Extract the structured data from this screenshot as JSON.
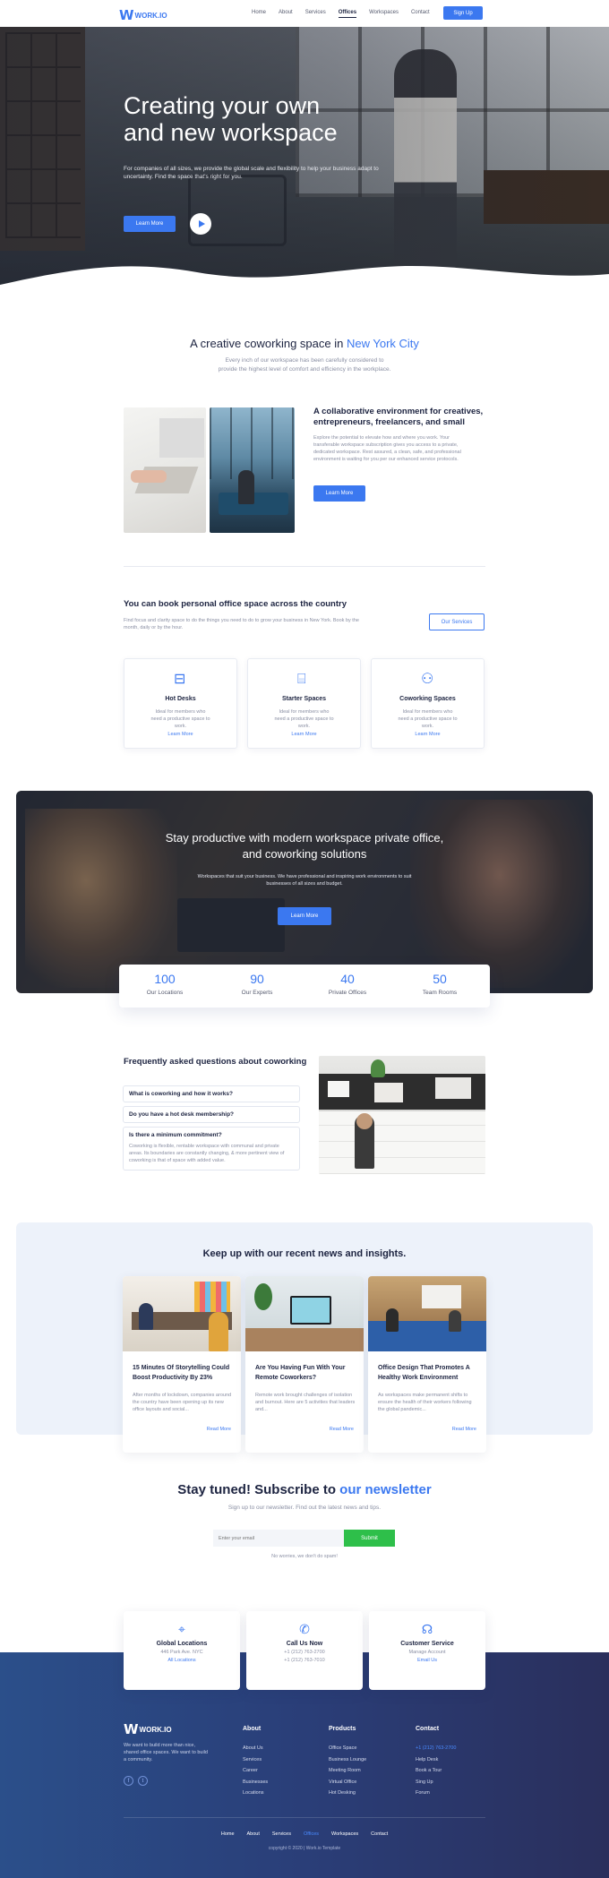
{
  "nav": {
    "logo_mark": "W",
    "logo_text": "WORK.IO",
    "links": [
      "Home",
      "About",
      "Services",
      "Offices",
      "Workspaces",
      "Contact"
    ],
    "active_link": "Offices",
    "signup": "Sign Up"
  },
  "hero": {
    "title_line1": "Creating your own",
    "title_line2": "and new workspace",
    "subtitle": "For companies of all sizes, we provide the global scale and flexibility to help your business adapt to uncertainty. Find the space that's right for you.",
    "button": "Learn More"
  },
  "coworking": {
    "title_prefix": "A creative coworking space in",
    "title_accent": "New York City",
    "subtitle_line1": "Every inch of our workspace has been carefully considered to",
    "subtitle_line2": "provide the highest level of comfort and efficiency in the workplace.",
    "feature_title": "A collaborative environment for creatives, entrepreneurs, freelancers, and small",
    "feature_text": "Explore the potential to elevate how and where you work. Your transferable workspace subscription gives you access to a private, dedicated workspace. Rest assured, a clean, safe, and professional environment is waiting for you per our enhanced service protocols.",
    "feature_button": "Learn More"
  },
  "offices": {
    "title": "You can book personal office space across the country",
    "text": "Find focus and clarity space to do the things you need to do to grow your business in New York. Book by the month, daily or by the hour.",
    "button": "Our Services",
    "cards": [
      {
        "icon": "desk-icon",
        "title": "Hot Desks",
        "text": "Ideal for members who need a productive space to work.",
        "link": "Learn More"
      },
      {
        "icon": "whiteboard-icon",
        "title": "Starter Spaces",
        "text": "Ideal for members who need a productive space to work.",
        "link": "Learn More"
      },
      {
        "icon": "people-icon",
        "title": "Coworking Spaces",
        "text": "Ideal for members who need a productive space to work.",
        "link": "Learn More"
      }
    ]
  },
  "banner": {
    "title": "Stay productive with modern workspace private office, and coworking solutions",
    "text": "Workspaces that suit your business. We have professional and inspiring work environments to suit businesses of all sizes and budget.",
    "button": "Learn More",
    "stats": [
      {
        "value": "100",
        "label": "Our Locations"
      },
      {
        "value": "90",
        "label": "Our Experts"
      },
      {
        "value": "40",
        "label": "Private Offices"
      },
      {
        "value": "50",
        "label": "Team Rooms"
      }
    ]
  },
  "faq": {
    "title": "Frequently asked questions about coworking",
    "items": [
      {
        "q": "What is coworking and how it works?"
      },
      {
        "q": "Do you have a hot desk membership?"
      },
      {
        "q": "Is there a minimum commitment?",
        "a": "Coworking is flexible, rentable workspace with communal and private areas. Its boundaries are constantly changing, & more pertinent view of coworking is that of space with added value."
      }
    ]
  },
  "news": {
    "title": "Keep up with our recent news and insights.",
    "items": [
      {
        "title": "15 Minutes Of Storytelling Could Boost Productivity By 23%",
        "text": "After months of lockdown, companies around the country have been opening up its new office layouts and social...",
        "link": "Read More"
      },
      {
        "title": "Are You Having Fun With Your Remote Coworkers?",
        "text": "Remote work brought challenges of isolation and burnout. Here are 5 activities that leaders and...",
        "link": "Read More"
      },
      {
        "title": "Office Design That Promotes A Healthy Work Environment",
        "text": "As workspaces make permanent shifts to ensure the health of their workers following the global pandemic...",
        "link": "Read More"
      }
    ]
  },
  "subscribe": {
    "title_prefix": "Stay tuned! Subscribe to",
    "title_accent": "our newsletter",
    "subtitle": "Sign up to our newsletter. Find out the latest news and tips.",
    "placeholder": "Enter your email",
    "button": "Submit",
    "note": "No worries, we don't do spam!"
  },
  "contact": [
    {
      "icon": "map-icon",
      "title": "Global Locations",
      "line": "446 Park Ave. NYC",
      "link": "All Locations"
    },
    {
      "icon": "phone-icon",
      "title": "Call Us Now",
      "line": "+1 (212) 763-2700",
      "line2": "+1 (212) 763-7010"
    },
    {
      "icon": "headset-icon",
      "title": "Customer Service",
      "line": "Manage Account",
      "link": "Email Us"
    }
  ],
  "footer": {
    "logo_text": "WORK.IO",
    "about_text": "We want to build more than nice, shared office spaces. We want to build a community.",
    "columns": [
      {
        "title": "About",
        "items": [
          "About Us",
          "Services",
          "Career",
          "Businesses",
          "Locations"
        ]
      },
      {
        "title": "Products",
        "items": [
          "Office Space",
          "Business Lounge",
          "Meeting Room",
          "Virtual Office",
          "Hot Desking"
        ]
      },
      {
        "title": "Contact",
        "items": [
          "+1 (212) 763-2700",
          "Help Desk",
          "Book a Tour",
          "Sing Up",
          "Forum"
        ]
      }
    ],
    "bottom_links": [
      "Home",
      "About",
      "Services",
      "Offices",
      "Workspaces",
      "Contact"
    ],
    "active_bottom": "Offices",
    "copyright": "copyright © 2020 | Work.io Template"
  },
  "colors": {
    "accent": "#3b78f0",
    "submit": "#2ebf4a",
    "footer": "#2a3e78"
  }
}
